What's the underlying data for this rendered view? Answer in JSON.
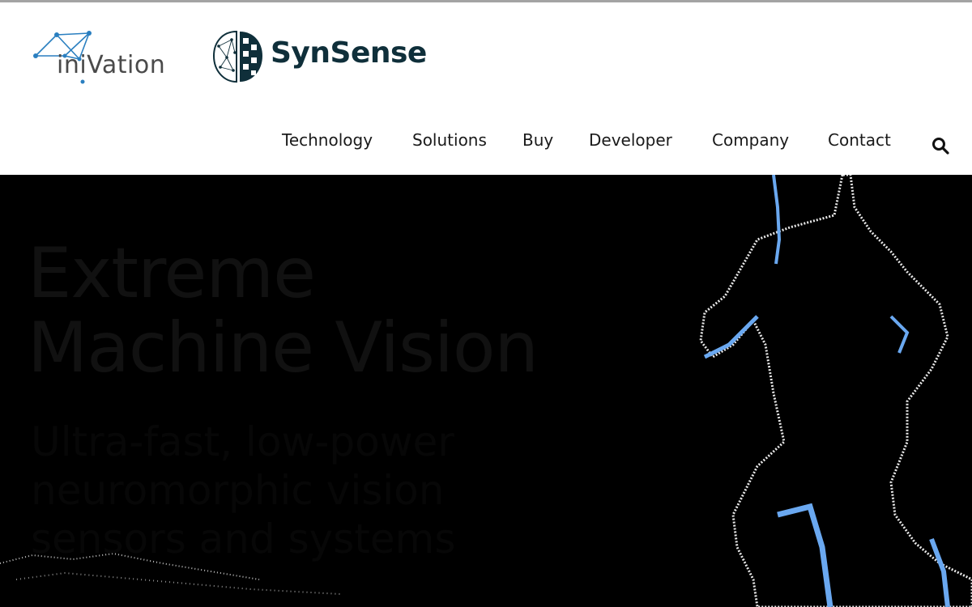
{
  "brand": {
    "inivation_text": "iniVation",
    "synsense_text": "SynSense"
  },
  "nav": {
    "items": [
      {
        "label": "Technology"
      },
      {
        "label": "Solutions"
      },
      {
        "label": "Buy"
      },
      {
        "label": "Developer"
      },
      {
        "label": "Company"
      },
      {
        "label": "Contact"
      }
    ],
    "search_icon": "search-icon"
  },
  "hero": {
    "title_line1": "Extreme",
    "title_line2": "Machine Vision",
    "subtitle": "Ultra-fast, low-power neuromorphic vision sensors and systems"
  },
  "colors": {
    "accent_blue": "#4a90e2",
    "brand_dark": "#0f2f3a",
    "inivation_blue": "#2a7fc0",
    "hero_bg": "#000000"
  }
}
